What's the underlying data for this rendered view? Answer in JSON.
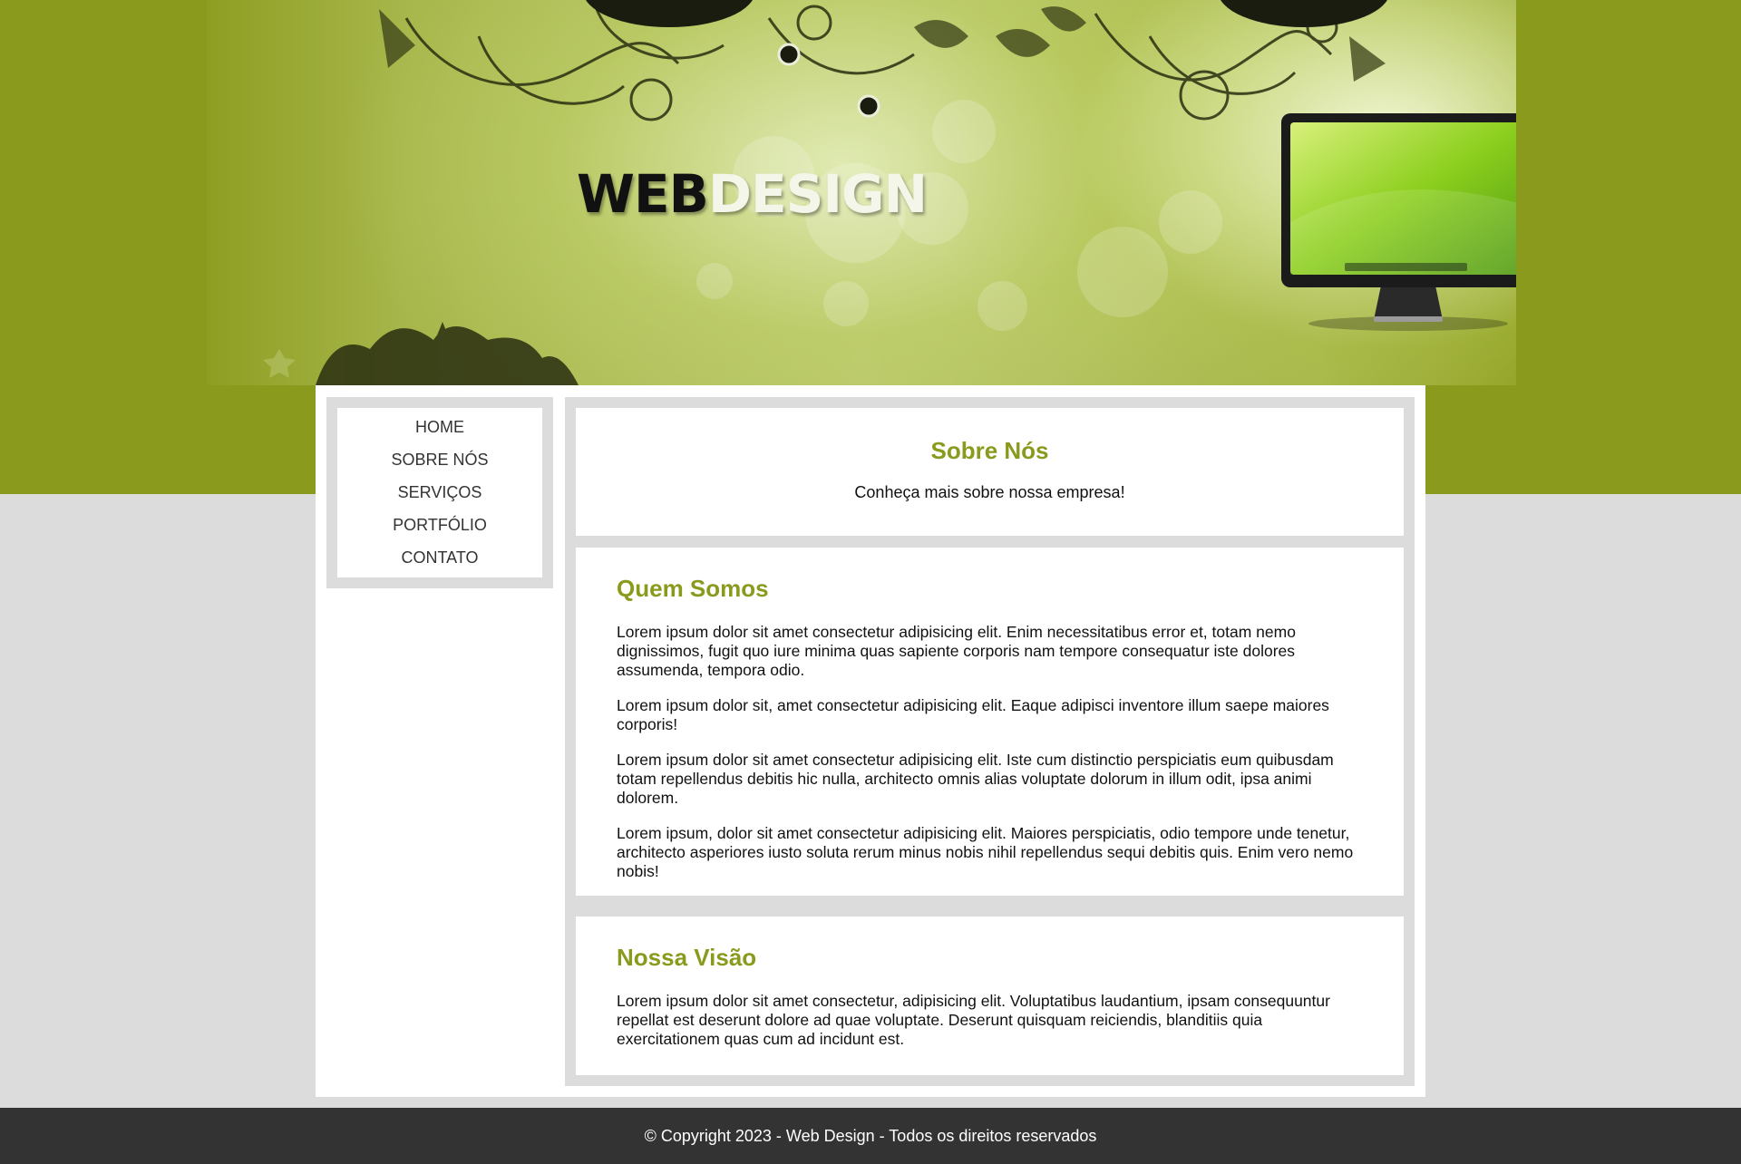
{
  "header": {
    "logo_part1": "WEB",
    "logo_part2": "DESIGN"
  },
  "nav": {
    "items": [
      {
        "label": "HOME"
      },
      {
        "label": "SOBRE NÓS"
      },
      {
        "label": "SERVIÇOS"
      },
      {
        "label": "PORTFÓLIO"
      },
      {
        "label": "CONTATO"
      }
    ]
  },
  "hero": {
    "title": "Sobre Nós",
    "subtitle": "Conheça mais sobre nossa empresa!"
  },
  "about": {
    "title": "Quem Somos",
    "paragraphs": [
      "Lorem ipsum dolor sit amet consectetur adipisicing elit. Enim necessitatibus error et, totam nemo dignissimos, fugit quo iure minima quas sapiente corporis nam tempore consequatur iste dolores assumenda, tempora odio.",
      "Lorem ipsum dolor sit, amet consectetur adipisicing elit. Eaque adipisci inventore illum saepe maiores corporis!",
      "Lorem ipsum dolor sit amet consectetur adipisicing elit. Iste cum distinctio perspiciatis eum quibusdam totam repellendus debitis hic nulla, architecto omnis alias voluptate dolorum in illum odit, ipsa animi dolorem.",
      "Lorem ipsum, dolor sit amet consectetur adipisicing elit. Maiores perspiciatis, odio tempore unde tenetur, architecto asperiores iusto soluta rerum minus nobis nihil repellendus sequi debitis quis. Enim vero nemo nobis!"
    ]
  },
  "vision": {
    "title": "Nossa Visão",
    "paragraphs": [
      "Lorem ipsum dolor sit amet consectetur, adipisicing elit. Voluptatibus laudantium, ipsam consequuntur repellat est deserunt dolore ad quae voluptate. Deserunt quisquam reiciendis, blanditiis quia exercitationem quas cum ad incidunt est."
    ]
  },
  "footer": {
    "text": "© Copyright 2023 - Web Design - Todos os direitos reservados"
  },
  "colors": {
    "accent": "#8a9a1c",
    "page_background": "#dcdcdc",
    "footer_background": "#333333"
  }
}
